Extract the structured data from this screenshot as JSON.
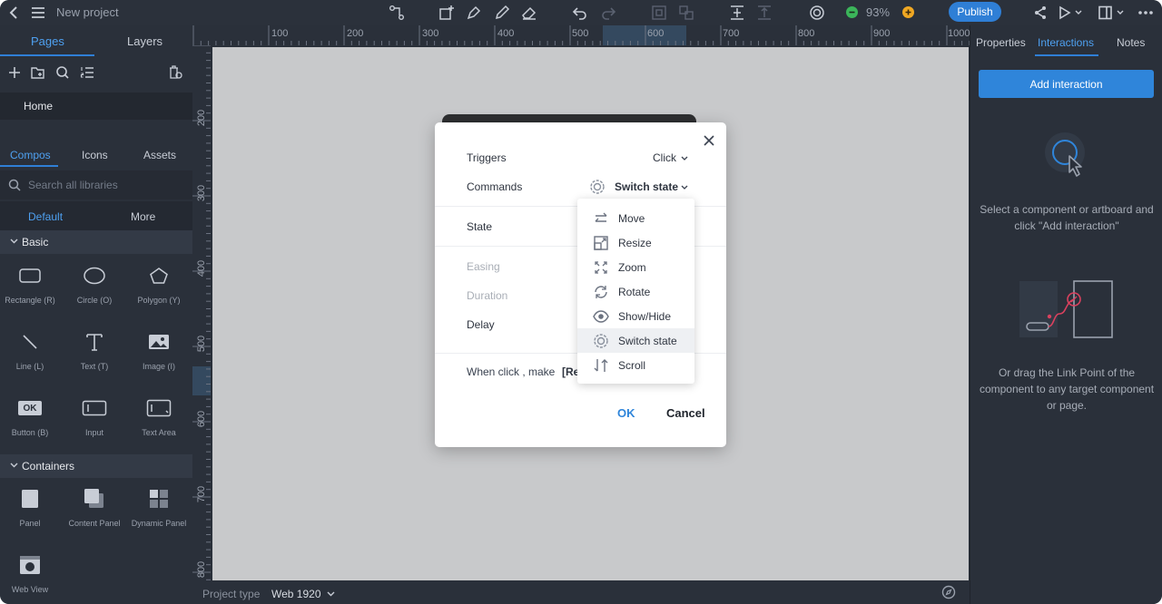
{
  "header": {
    "title": "New project",
    "zoom": "93%",
    "publish_label": "Publish",
    "icons": [
      "back-icon",
      "menu-icon",
      "path-tool-icon",
      "add-frame-icon",
      "pen-icon",
      "pencil-icon",
      "eraser-icon",
      "undo-icon",
      "redo-icon",
      "align-icon",
      "distribute-icon",
      "vertical-align-icon",
      "spacing-icon",
      "target-icon",
      "zoom-out-icon",
      "zoom-in-icon",
      "share-icon",
      "play-icon",
      "layout-icon",
      "more-icon"
    ]
  },
  "left_panel": {
    "tabs": [
      {
        "label": "Pages"
      },
      {
        "label": "Layers"
      }
    ],
    "active_tab": "Pages",
    "pages": [
      {
        "label": "Home"
      }
    ],
    "library_tabs": [
      {
        "label": "Compos"
      },
      {
        "label": "Icons"
      },
      {
        "label": "Assets"
      }
    ],
    "search_placeholder": "Search all libraries",
    "sub_tabs": [
      {
        "label": "Default"
      },
      {
        "label": "More"
      }
    ],
    "sections": [
      {
        "title": "Basic",
        "items": [
          {
            "label": "Rectangle (R)"
          },
          {
            "label": "Circle (O)"
          },
          {
            "label": "Polygon (Y)"
          },
          {
            "label": "Line (L)"
          },
          {
            "label": "Text (T)"
          },
          {
            "label": "Image (I)"
          },
          {
            "label": "Button (B)",
            "badge": "OK"
          },
          {
            "label": "Input"
          },
          {
            "label": "Text Area"
          }
        ]
      },
      {
        "title": "Containers",
        "items": [
          {
            "label": "Panel"
          },
          {
            "label": "Content Panel"
          },
          {
            "label": "Dynamic Panel"
          },
          {
            "label": "Web View"
          }
        ]
      }
    ]
  },
  "rulers": {
    "top": [
      "100",
      "200",
      "300",
      "400",
      "500",
      "600",
      "700",
      "800",
      "900",
      "1000"
    ],
    "left": [
      "200",
      "300",
      "400",
      "500",
      "600",
      "700",
      "800"
    ]
  },
  "bottom_bar": {
    "project_type_label": "Project type",
    "project_type_value": "Web 1920"
  },
  "right_panel": {
    "tabs": [
      {
        "label": "Properties"
      },
      {
        "label": "Interactions"
      },
      {
        "label": "Notes"
      }
    ],
    "active_tab": "Interactions",
    "add_button": "Add interaction",
    "hint_top": "Select a component or artboard and click \"Add interaction\"",
    "hint_bottom": "Or drag the Link Point of the component to any target component or page."
  },
  "modal": {
    "triggers_label": "Triggers",
    "trigger_value": "Click",
    "commands_label": "Commands",
    "command_value": "Switch state",
    "state_label": "State",
    "easing_label": "Easing",
    "duration_label": "Duration",
    "delay_label": "Delay",
    "summary_prefix": "When click , make",
    "summary_tag": "[Re",
    "ok_label": "OK",
    "cancel_label": "Cancel"
  },
  "dropdown": {
    "selected": "Switch state",
    "items": [
      {
        "label": "Move",
        "icon": "move-icon"
      },
      {
        "label": "Resize",
        "icon": "resize-icon"
      },
      {
        "label": "Zoom",
        "icon": "zoom-icon"
      },
      {
        "label": "Rotate",
        "icon": "rotate-icon"
      },
      {
        "label": "Show/Hide",
        "icon": "eye-icon"
      },
      {
        "label": "Switch state",
        "icon": "switch-state-icon"
      },
      {
        "label": "Scroll",
        "icon": "scroll-icon"
      }
    ]
  },
  "colors": {
    "accent": "#2f85da",
    "panel": "#2a303a",
    "canvas": "#c8c9cb",
    "green": "#3bb55a",
    "orange": "#f0a823"
  }
}
